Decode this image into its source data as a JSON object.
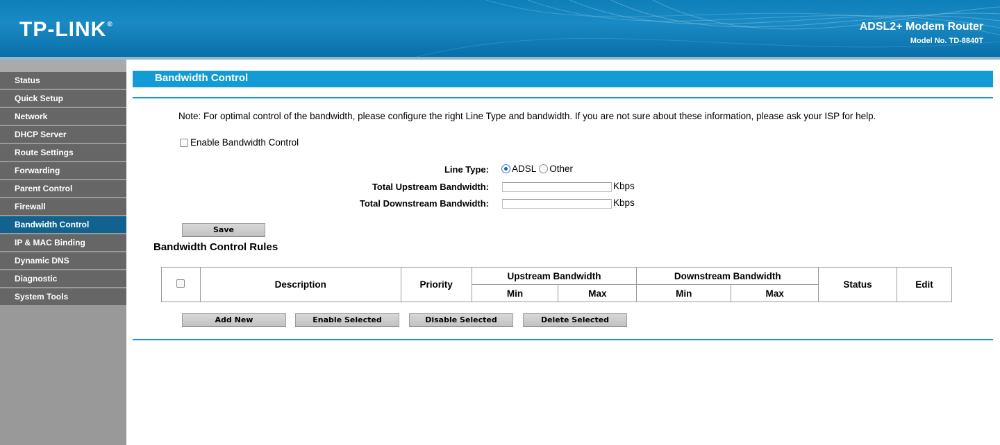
{
  "header": {
    "logo": "TP-LINK",
    "logo_mark": "®",
    "product": "ADSL2+ Modem Router",
    "model": "Model No. TD-8840T"
  },
  "sidebar": {
    "items": [
      {
        "label": "Status",
        "active": false
      },
      {
        "label": "Quick Setup",
        "active": false
      },
      {
        "label": "Network",
        "active": false
      },
      {
        "label": "DHCP Server",
        "active": false
      },
      {
        "label": "Route Settings",
        "active": false
      },
      {
        "label": "Forwarding",
        "active": false
      },
      {
        "label": "Parent Control",
        "active": false
      },
      {
        "label": "Firewall",
        "active": false
      },
      {
        "label": "Bandwidth Control",
        "active": true
      },
      {
        "label": "IP & MAC Binding",
        "active": false
      },
      {
        "label": "Dynamic DNS",
        "active": false
      },
      {
        "label": "Diagnostic",
        "active": false
      },
      {
        "label": "System Tools",
        "active": false
      }
    ]
  },
  "main": {
    "title": "Bandwidth Control",
    "note": "Note: For optimal control of the bandwidth, please configure the right Line Type and bandwidth. If you are not sure about these information, please ask your ISP for help.",
    "enable_label": "Enable Bandwidth Control",
    "enable_checked": false,
    "line_type_label": "Line Type:",
    "line_type_options": [
      "ADSL",
      "Other"
    ],
    "line_type_selected": "ADSL",
    "upstream_label": "Total Upstream Bandwidth:",
    "upstream_value": "",
    "downstream_label": "Total Downstream Bandwidth:",
    "downstream_value": "",
    "unit": "Kbps",
    "save_label": "Save"
  },
  "rules": {
    "heading": "Bandwidth Control Rules",
    "columns": {
      "description": "Description",
      "priority": "Priority",
      "upstream": "Upstream Bandwidth",
      "downstream": "Downstream Bandwidth",
      "status": "Status",
      "edit": "Edit",
      "min": "Min",
      "max": "Max"
    },
    "rows": [],
    "buttons": {
      "add_new": "Add New",
      "enable_selected": "Enable Selected",
      "disable_selected": "Disable Selected",
      "delete_selected": "Delete Selected"
    }
  },
  "colors": {
    "header_blue": "#0f7fb9",
    "title_blue": "#139bd6",
    "nav_gray": "#666666",
    "nav_active": "#12628f",
    "sidebar_bg": "#999999"
  }
}
